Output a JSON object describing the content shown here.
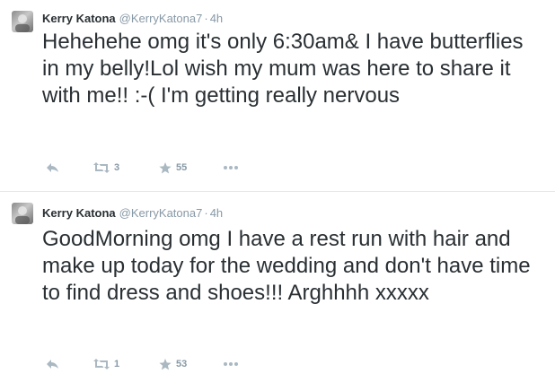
{
  "colors": {
    "text": "#292f33",
    "secondary": "#8899a6",
    "divider": "#e1e8ed"
  },
  "tweets": [
    {
      "fullname": "Kerry Katona",
      "username": "@KerryKatona7",
      "separator": "·",
      "time": "4h",
      "text": "Hehehehe omg it's only 6:30am& I have butterflies in my belly!Lol wish my mum was here to share it with me!! :-( I'm getting really nervous",
      "retweets": "3",
      "favorites": "55",
      "icons": [
        "reply-icon",
        "retweet-icon",
        "favorite-icon",
        "more-icon"
      ]
    },
    {
      "fullname": "Kerry Katona",
      "username": "@KerryKatona7",
      "separator": "·",
      "time": "4h",
      "text": "GoodMorning omg I have a rest run with hair and make up today for the wedding and don't have time to find dress and shoes!!! Arghhhh xxxxx",
      "retweets": "1",
      "favorites": "53",
      "icons": [
        "reply-icon",
        "retweet-icon",
        "favorite-icon",
        "more-icon"
      ]
    }
  ]
}
